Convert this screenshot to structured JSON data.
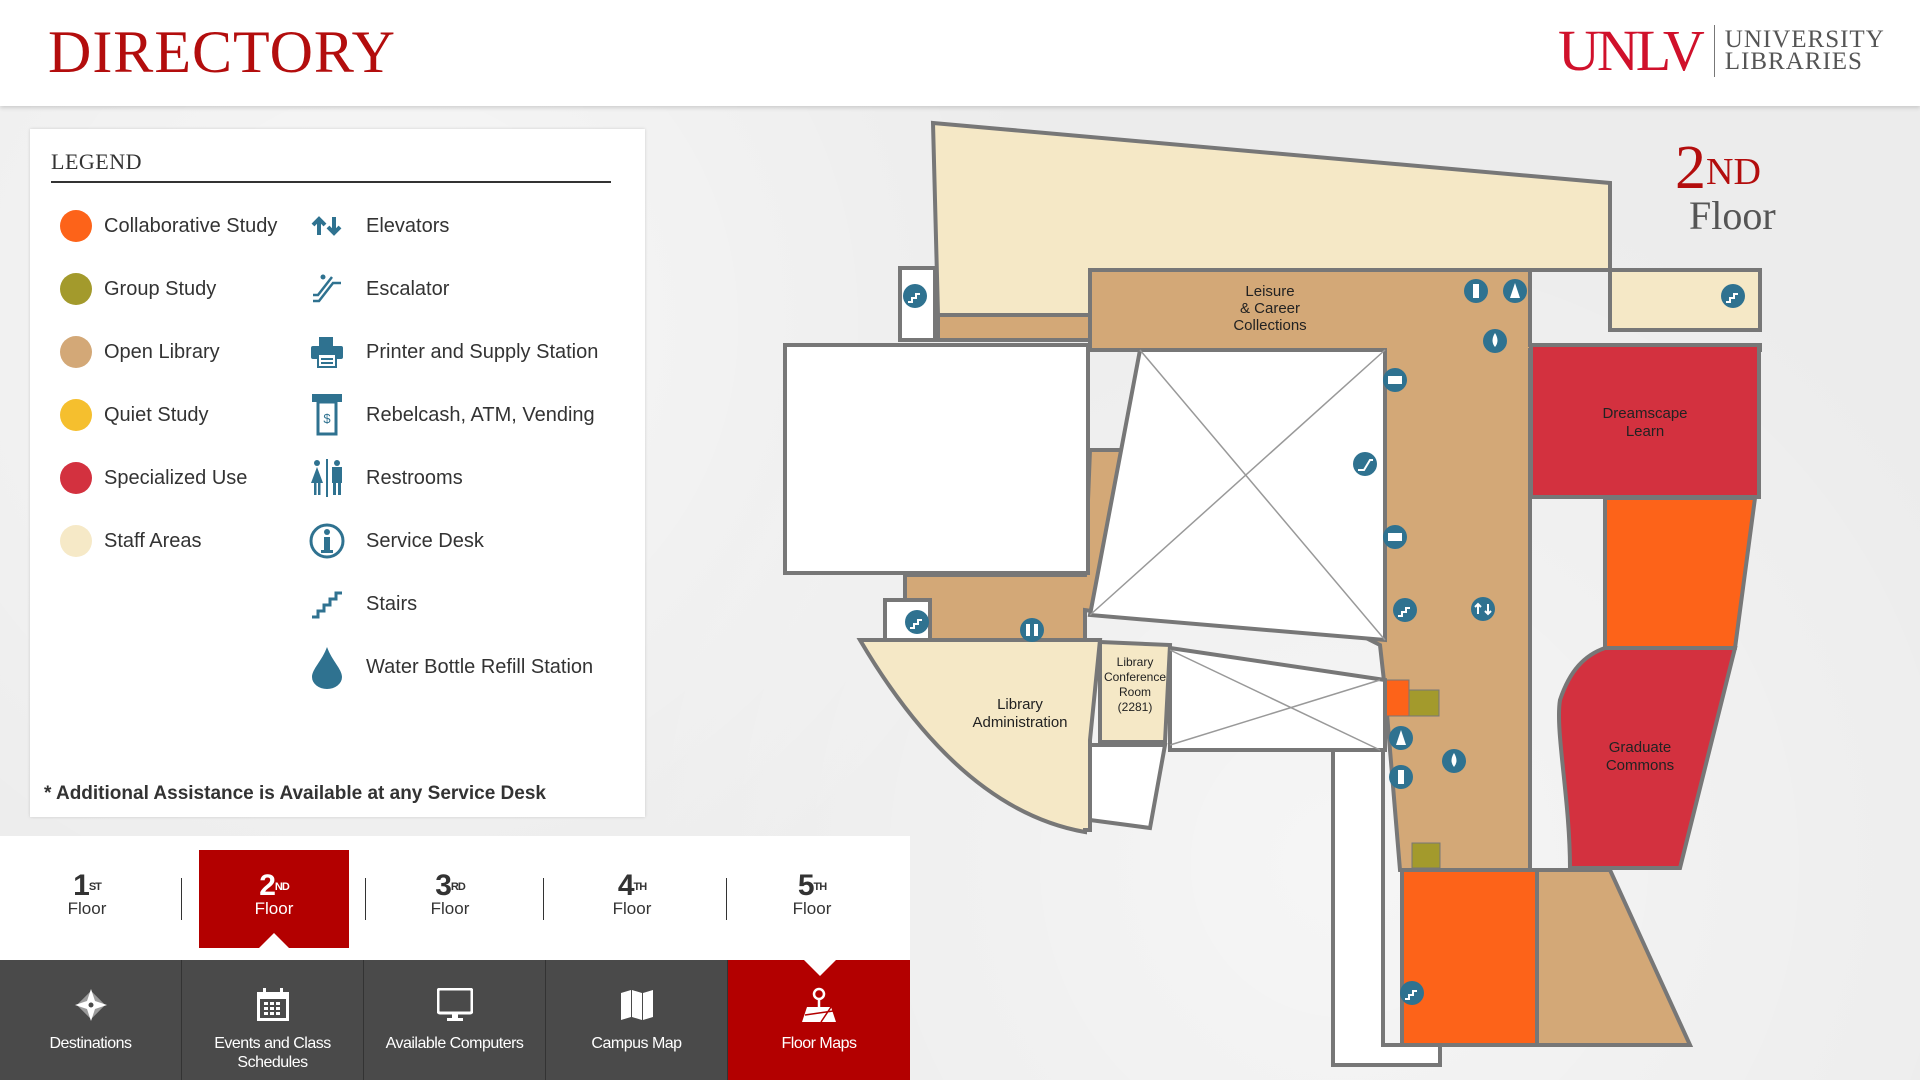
{
  "header": {
    "title": "DIRECTORY",
    "logo_primary": "UNLV",
    "logo_secondary_line1": "UNIVERSITY",
    "logo_secondary_line2": "LIBRARIES"
  },
  "legend": {
    "title": "LEGEND",
    "area_types": [
      {
        "label": "Collaborative Study",
        "color": "#fd6319"
      },
      {
        "label": "Group Study",
        "color": "#a39a2c"
      },
      {
        "label": "Open Library",
        "color": "#d3a877"
      },
      {
        "label": "Quiet Study",
        "color": "#f5bf2e"
      },
      {
        "label": "Specialized Use",
        "color": "#d3313f"
      },
      {
        "label": "Staff Areas",
        "color": "#f6e9c7"
      }
    ],
    "amenities": [
      {
        "label": "Elevators",
        "icon": "elevator-icon"
      },
      {
        "label": "Escalator",
        "icon": "escalator-icon"
      },
      {
        "label": "Printer and Supply Station",
        "icon": "printer-icon"
      },
      {
        "label": "Rebelcash, ATM, Vending",
        "icon": "atm-icon"
      },
      {
        "label": "Restrooms",
        "icon": "restroom-icon"
      },
      {
        "label": "Service Desk",
        "icon": "info-icon"
      },
      {
        "label": "Stairs",
        "icon": "stairs-icon"
      },
      {
        "label": "Water Bottle Refill Station",
        "icon": "water-drop-icon"
      }
    ],
    "footnote": "* Additional Assistance is Available at any Service Desk"
  },
  "floor_tabs": [
    {
      "num": "1",
      "suffix": "ST",
      "label": "Floor",
      "active": false
    },
    {
      "num": "2",
      "suffix": "ND",
      "label": "Floor",
      "active": true
    },
    {
      "num": "3",
      "suffix": "RD",
      "label": "Floor",
      "active": false
    },
    {
      "num": "4",
      "suffix": "TH",
      "label": "Floor",
      "active": false
    },
    {
      "num": "5",
      "suffix": "TH",
      "label": "Floor",
      "active": false
    }
  ],
  "nav": [
    {
      "label": "Destinations",
      "icon": "compass-star-icon",
      "active": false
    },
    {
      "label": "Events and Class Schedules",
      "icon": "calendar-icon",
      "active": false
    },
    {
      "label": "Available Computers",
      "icon": "monitor-icon",
      "active": false
    },
    {
      "label": "Campus Map",
      "icon": "folded-map-icon",
      "active": false
    },
    {
      "label": "Floor Maps",
      "icon": "floor-map-pin-icon",
      "active": true
    }
  ],
  "map": {
    "floor_num": "2",
    "floor_suffix": "ND",
    "floor_word": "Floor",
    "rooms": {
      "leisure": [
        "Leisure",
        "& Career",
        "Collections"
      ],
      "dreamscape": [
        "Dreamscape",
        "Learn"
      ],
      "graduate": [
        "Graduate",
        "Commons"
      ],
      "admin": [
        "Library",
        "Administration"
      ],
      "conference": [
        "Library",
        "Conference",
        "Room",
        "(2281)"
      ]
    }
  },
  "colors": {
    "brand_red": "#b30000",
    "icon_blue": "#2f7290",
    "nav_gray": "#4a4a4a"
  }
}
